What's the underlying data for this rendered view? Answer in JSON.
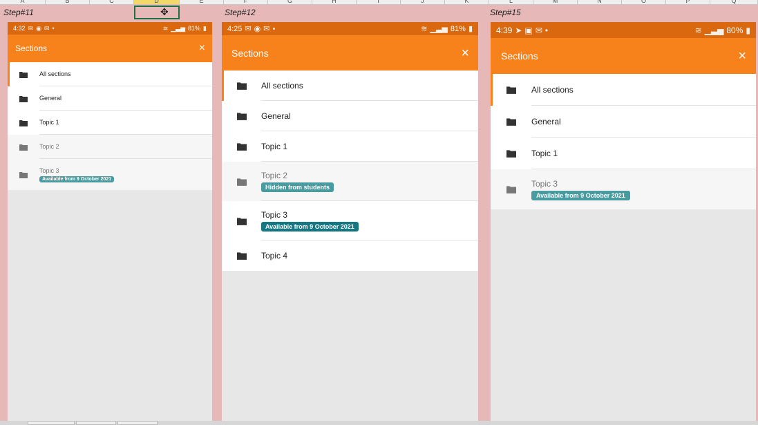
{
  "spreadsheet": {
    "columns": [
      "A",
      "B",
      "C",
      "D",
      "E",
      "F",
      "G",
      "H",
      "I",
      "J",
      "K",
      "L",
      "M",
      "N",
      "O",
      "P",
      "Q"
    ]
  },
  "steps": [
    {
      "label": "Step#11",
      "status": {
        "time": "4:32",
        "battery": "81%"
      },
      "header": {
        "title": "Sections",
        "close": "×"
      },
      "rows": [
        {
          "label": "All sections",
          "badge": null
        },
        {
          "label": "General",
          "badge": null
        },
        {
          "label": "Topic 1",
          "badge": null
        },
        {
          "label": "Topic 2",
          "badge": null
        },
        {
          "label": "Topic 3",
          "badge": "Available from 9 October 2021"
        }
      ]
    },
    {
      "label": "Step#12",
      "status": {
        "time": "4:25",
        "battery": "81%"
      },
      "header": {
        "title": "Sections",
        "close": "×"
      },
      "rows": [
        {
          "label": "All sections",
          "badge": null
        },
        {
          "label": "General",
          "badge": null
        },
        {
          "label": "Topic 1",
          "badge": null
        },
        {
          "label": "Topic 2",
          "badge": "Hidden from students"
        },
        {
          "label": "Topic 3",
          "badge": "Available from 9 October 2021"
        },
        {
          "label": "Topic 4",
          "badge": null
        }
      ]
    },
    {
      "label": "Step#15",
      "status": {
        "time": "4:39",
        "battery": "80%"
      },
      "header": {
        "title": "Sections",
        "close": "×"
      },
      "rows": [
        {
          "label": "All sections",
          "badge": null
        },
        {
          "label": "General",
          "badge": null
        },
        {
          "label": "Topic 1",
          "badge": null
        },
        {
          "label": "Topic 3",
          "badge": "Available from 9 October 2021"
        }
      ]
    }
  ],
  "icons": {
    "folder": "folder-icon",
    "close": "close-icon",
    "wifi": "wifi-icon",
    "signal": "signal-icon",
    "battery": "battery-icon",
    "mail": "mail-icon",
    "messenger": "messenger-icon"
  },
  "colors": {
    "status_bar": "#d9680f",
    "app_bar": "#f7821c",
    "badge_teal": "#4a9ba0",
    "badge_dark_teal": "#167783",
    "badge_hidden": "#4a9ba0",
    "background_pink": "#e6b8b7"
  }
}
